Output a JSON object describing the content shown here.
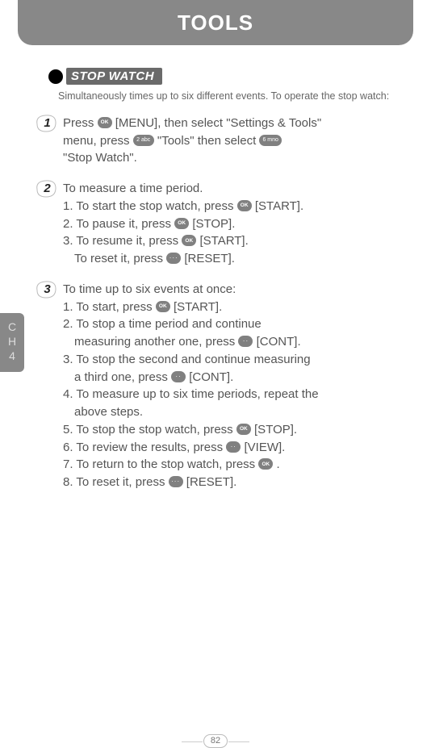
{
  "header": {
    "title": "TOOLS"
  },
  "section": {
    "label": "STOP WATCH"
  },
  "intro": "Simultaneously times up to six different events. To operate the stop watch:",
  "icons": {
    "ok": "OK",
    "key2": "2 abc",
    "key6": "6 mno",
    "dots2": "··",
    "dots3": "···"
  },
  "steps": {
    "s1": {
      "num": "1",
      "a": "Press ",
      "b": " [MENU], then select \"Settings & Tools\"",
      "c": "menu, press ",
      "d": " \"Tools\" then select ",
      "e": "\"Stop Watch\"."
    },
    "s2": {
      "num": "2",
      "title": "To measure a time period.",
      "l1a": "1. To start the stop watch, press ",
      "l1b": " [START].",
      "l2a": "2. To pause it, press ",
      "l2b": " [STOP].",
      "l3a": "3. To resume it, press ",
      "l3b": " [START].",
      "l4a": "To reset it, press ",
      "l4b": " [RESET]."
    },
    "s3": {
      "num": "3",
      "title": "To time up to six events at once:",
      "l1a": "1. To start, press ",
      "l1b": " [START].",
      "l2a": "2. To stop a time period and continue",
      "l2b": "measuring another one, press ",
      "l2c": " [CONT].",
      "l3a": "3. To stop the second and continue measuring",
      "l3b": "a third one, press ",
      "l3c": " [CONT].",
      "l4": "4. To measure up to six time periods, repeat the",
      "l4b": "above steps.",
      "l5a": "5. To stop the stop watch, press ",
      "l5b": " [STOP].",
      "l6a": "6. To review the results, press ",
      "l6b": " [VIEW].",
      "l7a": "7. To return to the stop watch, press ",
      "l7b": " .",
      "l8a": "8. To reset it, press ",
      "l8b": " [RESET]."
    }
  },
  "sidetab": {
    "line1": "C",
    "line2": "H",
    "line3": "4"
  },
  "page_number": "82"
}
